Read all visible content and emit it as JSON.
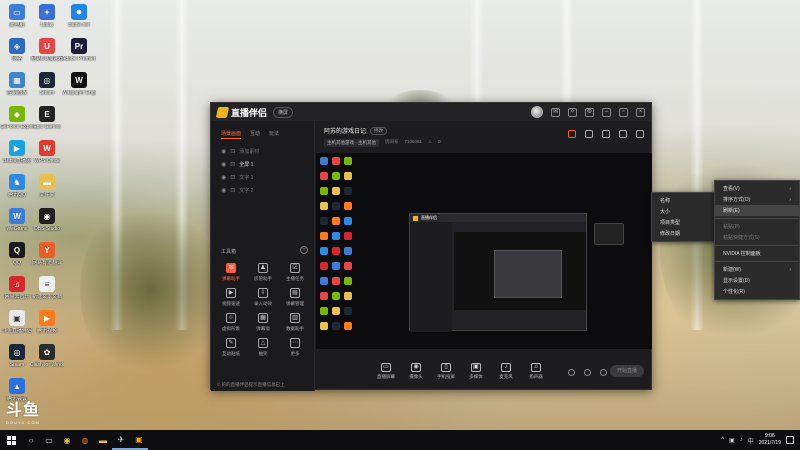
{
  "desktop": {
    "icons_col1": [
      {
        "label": "此电脑",
        "color": "#3b7dd8",
        "glyph": "▭"
      },
      {
        "label": "网络",
        "color": "#2d6bbf",
        "glyph": "◈"
      },
      {
        "label": "控制面板",
        "color": "#3f85c9",
        "glyph": "▦"
      },
      {
        "label": "GeForce Experience",
        "color": "#76b900",
        "glyph": "◆"
      },
      {
        "label": "Bilibili直播姬",
        "color": "#1aa3e0",
        "glyph": "▶"
      },
      {
        "label": "腾讯QQ",
        "color": "#2a8ae6",
        "glyph": "♞"
      },
      {
        "label": "WeGame",
        "color": "#3b7dd8",
        "glyph": "W"
      },
      {
        "label": "QQ",
        "color": "#1a1a1a",
        "glyph": "Q"
      },
      {
        "label": "网易云音乐",
        "color": "#d8262e",
        "glyph": "♫"
      },
      {
        "label": "斗鱼直播伴侣",
        "color": "#e8e8e8",
        "glyph": "▣"
      },
      {
        "label": "Steam",
        "color": "#1b2838",
        "glyph": "◎"
      },
      {
        "label": "腾讯会议",
        "color": "#2b70e0",
        "glyph": "▲"
      }
    ],
    "icons_col2": [
      {
        "label": "Uplay",
        "color": "#3b6fd8",
        "glyph": "✦"
      },
      {
        "label": "网易UU加速器",
        "color": "#e84545",
        "glyph": "U"
      },
      {
        "label": "Steam",
        "color": "#1b2838",
        "glyph": "◎"
      },
      {
        "label": "Epic Games",
        "color": "#222222",
        "glyph": "E"
      },
      {
        "label": "WPS Office",
        "color": "#e03c31",
        "glyph": "W"
      },
      {
        "label": "文件夹",
        "color": "#e8c050",
        "glyph": "▬"
      },
      {
        "label": "OBS Studio",
        "color": "#202020",
        "glyph": "◉"
      },
      {
        "label": "网易有道翻译",
        "color": "#e85d2a",
        "glyph": "Y"
      },
      {
        "label": "新建文本文档",
        "color": "#f0f0f0",
        "glyph": "≡"
      },
      {
        "label": "腾讯视频",
        "color": "#ff7a1a",
        "glyph": "▶"
      },
      {
        "label": "Clash for Windows",
        "color": "#2b2b2b",
        "glyph": "✿"
      }
    ],
    "icons_col3": [
      {
        "label": "Battle.net",
        "color": "#1f86e8",
        "glyph": "✸"
      },
      {
        "label": "Adobe Premiere",
        "color": "#1e1a3a",
        "glyph": "Pr"
      },
      {
        "label": "Wallpaper Engine",
        "color": "#101010",
        "glyph": "W"
      }
    ],
    "watermark": {
      "big": "斗鱼",
      "small": "DOUYU.COM"
    }
  },
  "app": {
    "logo_text": "直播伴侣",
    "version_badge": "横屏",
    "sidebar": {
      "tabs": [
        {
          "label": "场景画面",
          "active": true
        },
        {
          "label": "互动",
          "active": false
        },
        {
          "label": "玩法",
          "active": false
        }
      ],
      "scenes": [
        {
          "label": "添加素材",
          "on": false
        },
        {
          "label": "全屏 1",
          "on": true
        },
        {
          "label": "文字 1",
          "on": false
        },
        {
          "label": "文字 2",
          "on": false
        }
      ],
      "tools_heading": "工具箱",
      "tools_add": "+",
      "tools": [
        {
          "label": "弹幕助手",
          "glyph": "✉",
          "hot": true
        },
        {
          "label": "房管助手",
          "glyph": "♟",
          "hot": false
        },
        {
          "label": "主播任务",
          "glyph": "☑",
          "hot": false
        },
        {
          "label": "视频速递",
          "glyph": "▶",
          "hot": false
        },
        {
          "label": "录入动效",
          "glyph": "⇩",
          "hot": false
        },
        {
          "label": "弹幕管理",
          "glyph": "▤",
          "hot": false
        },
        {
          "label": "虚拟形象",
          "glyph": "☺",
          "hot": false
        },
        {
          "label": "弹幕墙",
          "glyph": "▦",
          "hot": false
        },
        {
          "label": "数据助手",
          "glyph": "▥",
          "hot": false
        },
        {
          "label": "互动贴纸",
          "glyph": "✎",
          "hot": false
        },
        {
          "label": "抽奖",
          "glyph": "△",
          "hot": false
        },
        {
          "label": "更多",
          "glyph": "⋯",
          "hot": false
        }
      ],
      "footer_note": "© 的的直播伴侣提示直播信息已上"
    },
    "room": {
      "title": "阿苏的游戏日记",
      "tag": "修改",
      "category": "主机其他游戏 · 主机其他",
      "room_label": "房间号",
      "room_id": "7106081",
      "heat": "0"
    },
    "controls": [
      {
        "label": "直播屏幕",
        "glyph": "▭"
      },
      {
        "label": "摄像头",
        "glyph": "◉"
      },
      {
        "label": "手机投屏",
        "glyph": "▯"
      },
      {
        "label": "多媒体",
        "glyph": "▣"
      },
      {
        "label": "麦克风",
        "glyph": "♪"
      },
      {
        "label": "扬声器",
        "glyph": "♫"
      }
    ],
    "start_button": "开始直播"
  },
  "nested_window": {
    "logo": "直播伴侣"
  },
  "context_menu_left": {
    "items": [
      {
        "label": "名称",
        "disabled": false
      },
      {
        "label": "大小",
        "disabled": false
      },
      {
        "label": "项目类型",
        "disabled": false
      },
      {
        "label": "修改日期",
        "disabled": false
      }
    ]
  },
  "context_menu_right": {
    "items": [
      {
        "label": "查看(V)",
        "arrow": "›",
        "disabled": false,
        "highlight": false
      },
      {
        "label": "排序方式(O)",
        "arrow": "›",
        "disabled": false,
        "highlight": false
      },
      {
        "label": "刷新(E)",
        "arrow": "",
        "disabled": false,
        "highlight": true
      },
      {
        "label": "粘贴(P)",
        "arrow": "",
        "disabled": true,
        "highlight": false
      },
      {
        "label": "粘贴快捷方式(S)",
        "arrow": "",
        "disabled": true,
        "highlight": false
      },
      {
        "label": "NVIDIA 控制面板",
        "arrow": "",
        "disabled": false,
        "highlight": false
      },
      {
        "label": "新建(W)",
        "arrow": "›",
        "disabled": false,
        "highlight": false
      },
      {
        "label": "显示设置(D)",
        "arrow": "",
        "disabled": false,
        "highlight": false
      },
      {
        "label": "个性化(R)",
        "arrow": "",
        "disabled": false,
        "highlight": false
      }
    ]
  },
  "taskbar": {
    "apps": [
      {
        "name": "chrome",
        "glyph": "◉",
        "color": "#e8c040"
      },
      {
        "name": "app-orange",
        "glyph": "◍",
        "color": "#e8782a"
      },
      {
        "name": "explorer",
        "glyph": "▬",
        "color": "#e8c050"
      },
      {
        "name": "pin",
        "glyph": "✈",
        "color": "#dddddd"
      },
      {
        "name": "douyu",
        "glyph": "▣",
        "color": "#f0a030"
      }
    ],
    "time": "9:06",
    "date": "2021/7/19",
    "lang": "中"
  }
}
